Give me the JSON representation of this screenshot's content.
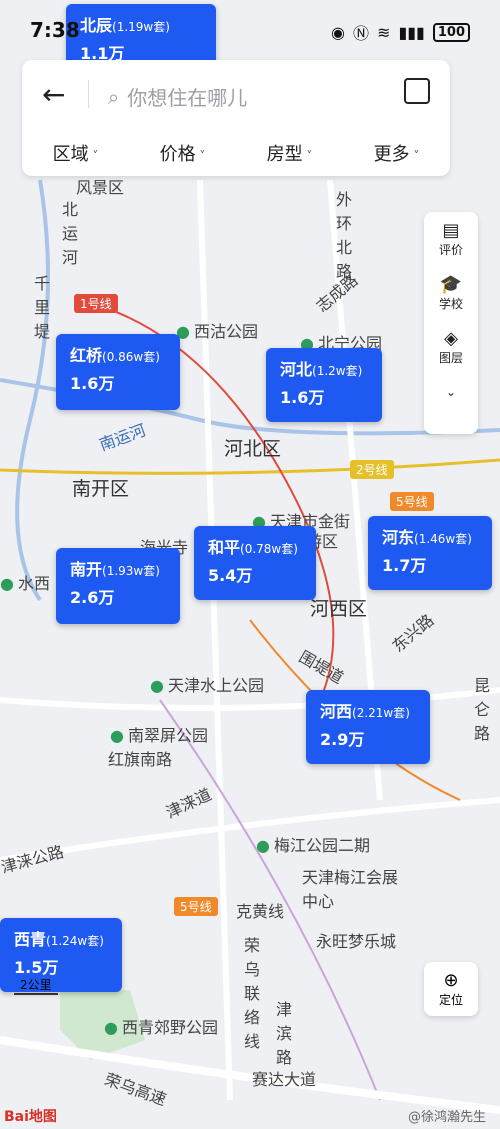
{
  "status": {
    "time": "7:38",
    "battery": "100"
  },
  "search": {
    "placeholder": "你想住在哪儿"
  },
  "filters": [
    "区域",
    "价格",
    "房型",
    "更多"
  ],
  "right_panel": [
    {
      "label": "评价",
      "icon": "review-icon"
    },
    {
      "label": "学校",
      "icon": "school-icon"
    },
    {
      "label": "图层",
      "icon": "layers-icon"
    }
  ],
  "locate_label": "定位",
  "bubbles": {
    "beichen": {
      "name": "北辰",
      "count": "(1.19w套)",
      "price": "1.1万"
    },
    "hongqiao": {
      "name": "红桥",
      "count": "(0.86w套)",
      "price": "1.6万"
    },
    "hebei": {
      "name": "河北",
      "count": "(1.2w套)",
      "price": "1.6万"
    },
    "heping": {
      "name": "和平",
      "count": "(0.78w套)",
      "price": "5.4万"
    },
    "hedong": {
      "name": "河东",
      "count": "(1.46w套)",
      "price": "1.7万"
    },
    "nankai": {
      "name": "南开",
      "count": "(1.93w套)",
      "price": "2.6万"
    },
    "hexi": {
      "name": "河西",
      "count": "(2.21w套)",
      "price": "2.9万"
    },
    "xiqing": {
      "name": "西青",
      "count": "(1.24w套)",
      "price": "1.5万"
    }
  },
  "map_labels": {
    "fengjing": "风景区",
    "beiyunhe": "北运河",
    "qianlidi": "千里堤",
    "xigu": "西沽公园",
    "beining": "北宁公园",
    "zhicheng": "志成路",
    "waihuan": "外环北路",
    "nanyunhe": "南运河",
    "hebeiqu": "河北区",
    "nankaiqu": "南开区",
    "jinjie": "天津市金街",
    "lvyouqu": "旅游区",
    "haiguangsi": "海光寺",
    "hexiqu": "河西区",
    "shuixi": "水西",
    "dongxing": "东兴路",
    "weidi": "围堤道",
    "shuishang": "天津水上公园",
    "nancuiping": "南翠屏公园",
    "hongqi": "红旗南路",
    "jinlai": "津涞道",
    "jinlaigl": "津涞公路",
    "meijiang": "梅江公园二期",
    "huizhan": "天津梅江会展中心",
    "kehuang": "克黄线",
    "rongwu": "荣乌联络线",
    "jinbin": "津滨路",
    "yongwang": "永旺梦乐城",
    "jiaoye": "西青郊野公园",
    "rongwugs": "荣乌高速",
    "saida": "赛达大道",
    "kunlun": "昆仑路"
  },
  "line_badges": {
    "l1": "1号线",
    "l2": "2号线",
    "l5a": "5号线",
    "l5b": "5号线"
  },
  "scale": "2公里",
  "logo": "Bai地图",
  "watermark": "@徐鸿瀚先生"
}
